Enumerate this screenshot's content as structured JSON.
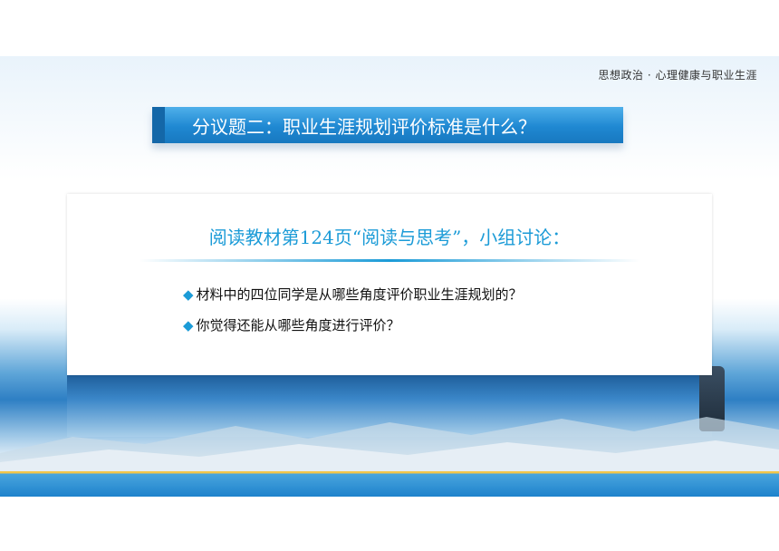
{
  "header": {
    "subject": "思想政治 · 心理健康与职业生涯"
  },
  "topic": {
    "title": "分议题二：职业生涯规划评价标准是什么？"
  },
  "card": {
    "title": "阅读教材第124页“阅读与思考”，小组讨论：",
    "questions": [
      {
        "bullet": "◆",
        "text": "材料中的四位同学是从哪些角度评价职业生涯规划的？"
      },
      {
        "bullet": "◆",
        "text": "你觉得还能从哪些角度进行评价？"
      }
    ]
  },
  "colors": {
    "accent": "#1b9bd7",
    "banner": "#1f88d2",
    "bottom_bar": "#1e82cc"
  }
}
